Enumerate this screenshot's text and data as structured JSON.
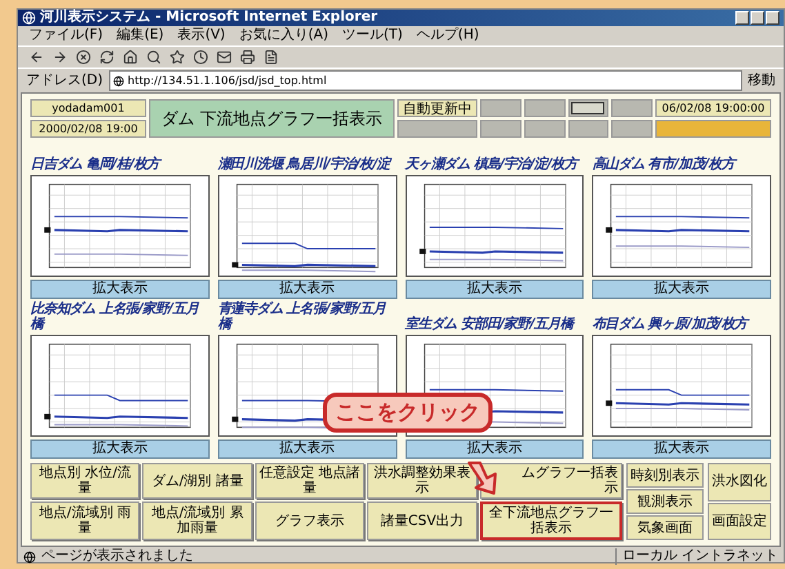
{
  "window": {
    "title": "河川表示システム - Microsoft Internet Explorer"
  },
  "menu": [
    "ファイル(F)",
    "編集(E)",
    "表示(V)",
    "お気に入り(A)",
    "ツール(T)",
    "ヘルプ(H)"
  ],
  "address": {
    "label": "アドレス(D)",
    "value": "http://134.51.1.106/jsd/jsd_top.html",
    "go": "移動"
  },
  "header": {
    "user": "yodadam001",
    "date": "2000/02/08 19:00",
    "title": "ダム 下流地点グラフ一括表示",
    "auto": "自動更新中",
    "clock": "06/02/08 19:00:00"
  },
  "charts": [
    {
      "title": "日吉ダム 亀岡/桂/枚方",
      "button": "拡大表示"
    },
    {
      "title": "瀬田川洗堰 鳥居川/宇治/枚/淀",
      "button": "拡大表示"
    },
    {
      "title": "天ヶ瀬ダム 槙島/宇治/淀/枚方",
      "button": "拡大表示"
    },
    {
      "title": "高山ダム 有市/加茂/枚方",
      "button": "拡大表示"
    },
    {
      "title": "比奈知ダム 上名張/家野/五月橋",
      "button": "拡大表示"
    },
    {
      "title": "青蓮寺ダム 上名張/家野/五月橋",
      "button": "拡大表示"
    },
    {
      "title": "室生ダム 安部田/家野/五月橋",
      "button": "拡大表示"
    },
    {
      "title": "布目ダム 興ヶ原/加茂/枚方",
      "button": "拡大表示"
    }
  ],
  "buttons": [
    {
      "label": "地点別 水位/流量",
      "highlighted": false
    },
    {
      "label": "ダム/湖別 諸量",
      "highlighted": false
    },
    {
      "label": "任意設定 地点諸量",
      "highlighted": false
    },
    {
      "label": "洪水調整効果表示",
      "highlighted": false
    },
    {
      "label": "ムグラフ一括表示",
      "highlighted": false
    },
    {
      "label": "地点/流域別 雨量",
      "highlighted": false
    },
    {
      "label": "地点/流域別 累加雨量",
      "highlighted": false
    },
    {
      "label": "グラフ表示",
      "highlighted": false
    },
    {
      "label": "諸量CSV出力",
      "highlighted": false
    },
    {
      "label": "全下流地点グラフ一括表示",
      "highlighted": true
    }
  ],
  "side_buttons": {
    "left": [
      "時刻別表示",
      "観測表示",
      "気象画面"
    ],
    "right": [
      "洪水図化",
      "画面設定"
    ]
  },
  "callout": "ここをクリック",
  "status_bar": {
    "message": "ページが表示されました",
    "zone": "ローカル イントラネット"
  }
}
